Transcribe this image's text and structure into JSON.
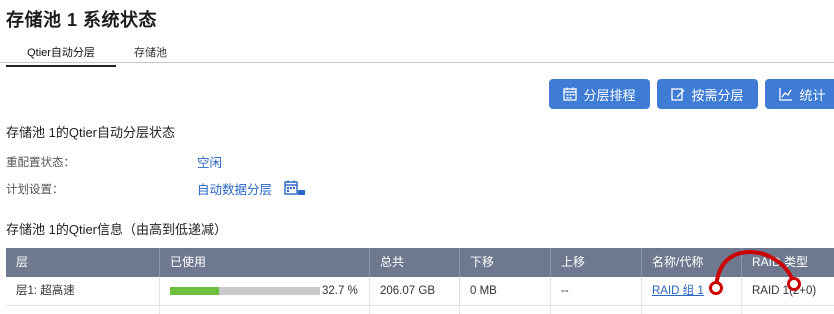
{
  "page": {
    "title": "存储池 1 系统状态"
  },
  "tabs": [
    {
      "label": "Qtier自动分层"
    },
    {
      "label": "存储池"
    }
  ],
  "toolbar": {
    "schedule_label": "分层排程",
    "ondemand_label": "按需分层",
    "stats_label": "统计",
    "icons": [
      "calendar-icon",
      "edit-icon",
      "chart-icon"
    ],
    "button_color": "#3e7cd6"
  },
  "status": {
    "heading": "存储池 1的Qtier自动分层状态",
    "reconfig_label": "重配置状态：",
    "reconfig_value": "空闲",
    "schedule_label": "计划设置：",
    "schedule_value": "自动数据分层"
  },
  "info": {
    "heading": "存储池 1的Qtier信息（由高到低递减）",
    "columns": [
      "层",
      "已使用",
      "总共",
      "下移",
      "上移",
      "名称/代称",
      "RAID 类型"
    ],
    "rows": [
      {
        "tier": "层1: 超高速",
        "used_fraction": 0.327,
        "used_text": "32.7 %",
        "total": "206.07 GB",
        "move_down": "0 MB",
        "move_up": "--",
        "name": "RAID 组 1",
        "raid_type": "RAID 1(2+0)"
      }
    ]
  },
  "colors": {
    "header_bg": "#6e7990",
    "bar_fill": "#6cbf3a",
    "link": "#2a66c4",
    "annotation": "#cc0000"
  }
}
